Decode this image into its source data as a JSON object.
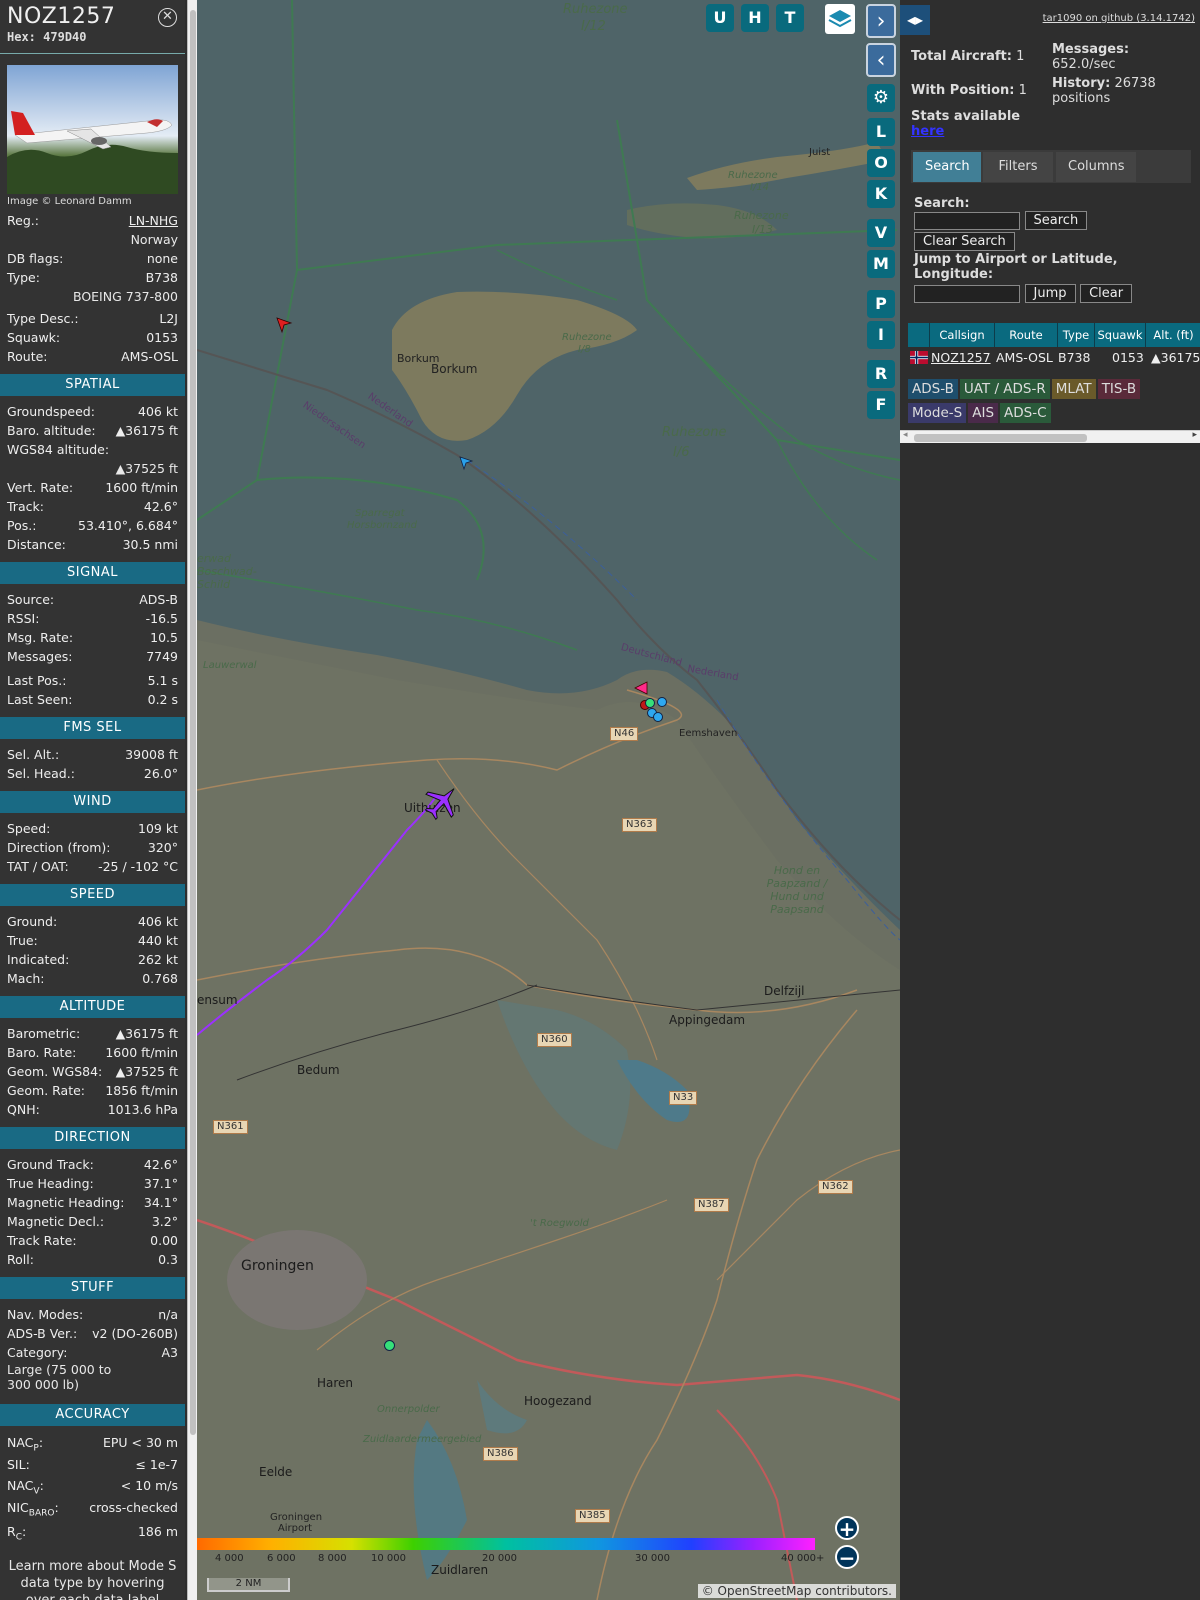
{
  "info": {
    "callsign": "NOZ1257",
    "hex_label": "Hex:",
    "hex": "479D40",
    "photo_credit": "Image © Leonard Damm",
    "reg_label": "Reg.:",
    "reg": "LN-NHG",
    "country": "Norway",
    "dbflags_label": "DB flags:",
    "dbflags": "none",
    "type_label": "Type:",
    "type": "B738",
    "type_full": "BOEING 737-800",
    "typedesc_label": "Type Desc.:",
    "typedesc": "L2J",
    "squawk_label": "Squawk:",
    "squawk": "0153",
    "route_label": "Route:",
    "route": "AMS-OSL"
  },
  "spatial": {
    "title": "SPATIAL",
    "groundspeed_label": "Groundspeed:",
    "groundspeed": "406 kt",
    "baro_label": "Baro. altitude:",
    "baro": "▲36175 ft",
    "wgs_label": "WGS84 altitude:",
    "wgs": "▲37525 ft",
    "vrate_label": "Vert. Rate:",
    "vrate": "1600 ft/min",
    "track_label": "Track:",
    "track": "42.6°",
    "pos_label": "Pos.:",
    "pos": "53.410°, 6.684°",
    "dist_label": "Distance:",
    "dist": "30.5 nmi"
  },
  "signal": {
    "title": "SIGNAL",
    "source_label": "Source:",
    "source": "ADS-B",
    "rssi_label": "RSSI:",
    "rssi": "-16.5",
    "msgrate_label": "Msg. Rate:",
    "msgrate": "10.5",
    "messages_label": "Messages:",
    "messages": "7749",
    "lastpos_label": "Last Pos.:",
    "lastpos": "5.1 s",
    "lastseen_label": "Last Seen:",
    "lastseen": "0.2 s"
  },
  "fms": {
    "title": "FMS SEL",
    "selalt_label": "Sel. Alt.:",
    "selalt": "39008 ft",
    "selhead_label": "Sel. Head.:",
    "selhead": "26.0°"
  },
  "wind": {
    "title": "WIND",
    "speed_label": "Speed:",
    "speed": "109 kt",
    "dir_label": "Direction (from):",
    "dir": "320°",
    "tat_label": "TAT / OAT:",
    "tat": "-25 / -102 °C"
  },
  "speed": {
    "title": "SPEED",
    "ground_label": "Ground:",
    "ground": "406 kt",
    "true_label": "True:",
    "true": "440 kt",
    "indicated_label": "Indicated:",
    "indicated": "262 kt",
    "mach_label": "Mach:",
    "mach": "0.768"
  },
  "altitude": {
    "title": "ALTITUDE",
    "baro_label": "Barometric:",
    "baro": "▲36175 ft",
    "barorate_label": "Baro. Rate:",
    "barorate": "1600 ft/min",
    "geom_label": "Geom. WGS84:",
    "geom": "▲37525 ft",
    "geomrate_label": "Geom. Rate:",
    "geomrate": "1856 ft/min",
    "qnh_label": "QNH:",
    "qnh": "1013.6 hPa"
  },
  "direction": {
    "title": "DIRECTION",
    "gtrack_label": "Ground Track:",
    "gtrack": "42.6°",
    "thead_label": "True Heading:",
    "thead": "37.1°",
    "mhead_label": "Magnetic Heading:",
    "mhead": "34.1°",
    "mdecl_label": "Magnetic Decl.:",
    "mdecl": "3.2°",
    "trate_label": "Track Rate:",
    "trate": "0.00",
    "roll_label": "Roll:",
    "roll": "0.3"
  },
  "stuff": {
    "title": "STUFF",
    "navmodes_label": "Nav. Modes:",
    "navmodes": "n/a",
    "adsbver_label": "ADS-B Ver.:",
    "adsbver": "v2 (DO-260B)",
    "category_label": "Category:",
    "category": "A3",
    "catdesc": "Large (75 000 to 300 000 lb)"
  },
  "accuracy": {
    "title": "ACCURACY",
    "nacp_label": "NAC",
    "nacp_sub": "P",
    "nacp": "EPU < 30 m",
    "sil_label": "SIL:",
    "sil": "≤ 1e-7",
    "nacv_label": "NAC",
    "nacv_sub": "V",
    "nacv": "< 10 m/s",
    "nicbaro_label": "NIC",
    "nicbaro_sub": "BARO",
    "nicbaro": "cross-checked",
    "rc_label": "R",
    "rc_sub": "C",
    "rc": "186 m"
  },
  "footer_text": "Learn more about Mode S data type by hovering over each data label",
  "map": {
    "buttons": [
      "U",
      "H",
      "T"
    ],
    "side_buttons": [
      "L",
      "O",
      "K",
      "V",
      "M",
      "P",
      "I",
      "R",
      "F"
    ],
    "labels": {
      "ruhezone_i12": "Ruhezone",
      "ruhezone_i12b": "I/12",
      "ruhezone_i6": "Ruhezone",
      "ruhezone_i6b": "I/6",
      "ruhezone_i14": "Ruhezone",
      "ruhezone_i14b": "I/14",
      "ruhezone_i13": "Ruhezone",
      "ruhezone_i13b": "I/13",
      "ruhezone_i8": "Ruhezone",
      "ruhezone_i8b": "I/8",
      "juist": "Juist",
      "borkum1": "Borkum",
      "borkum2": "Borkum",
      "sparregat": "Sparregat",
      "horsbornzand": "Horsbornzand",
      "nederland1": "Nederland",
      "niedersachsen": "Niedersachsen",
      "deutschland": "Deutschland",
      "nederland2": "Nederland",
      "eemshaven": "Eemshaven",
      "uithuizen": "Uithuizen",
      "groningen": "Groningen",
      "appingedam": "Appingedam",
      "delfzijl": "Delfzijl",
      "bedum": "Bedum",
      "haren": "Haren",
      "hoogezand": "Hoogezand",
      "eelde": "Eelde",
      "groningen_airport": "Groningen Airport",
      "zuidlaren": "Zuidlaren",
      "hond": "Hond en Paapzand / Hund und Paapsand",
      "roegwold": "'t Roegwold",
      "onnerpolder": "Onnerpolder",
      "zuidlaardermeergebied": "Zuidlaardermeergebied",
      "lauwerwal": "Lauwerwal",
      "boschwad": "erwad Boschwad-Schild",
      "ensum": "ensum"
    },
    "roads": [
      "N46",
      "N363",
      "N360",
      "N33",
      "N361",
      "N387",
      "N362",
      "N386",
      "N385"
    ],
    "scale": "2 NM",
    "attribution": "© OpenStreetMap contributors.",
    "legend_ticks": [
      "4 000",
      "6 000",
      "8 000",
      "10 000",
      "20 000",
      "30 000",
      "40 000+"
    ]
  },
  "sidebar": {
    "github": "tar1090 on github (3.14.1742)",
    "total_aircraft_label": "Total Aircraft:",
    "total_aircraft": "1",
    "with_position_label": "With Position:",
    "with_position": "1",
    "stats_label": "Stats available",
    "stats_link": "here",
    "messages_label": "Messages:",
    "messages": "652.0/sec",
    "history_label": "History:",
    "history": "26738 positions",
    "tabs": [
      "Search",
      "Filters",
      "Columns"
    ],
    "search_label": "Search:",
    "search_btn": "Search",
    "clear_search_btn": "Clear Search",
    "jump_label": "Jump to Airport or Latitude, Longitude:",
    "jump_btn": "Jump",
    "clear_btn": "Clear",
    "columns": [
      "Callsign",
      "Route",
      "Type",
      "Squawk",
      "Alt. (ft)"
    ],
    "rows": [
      {
        "callsign": "NOZ1257",
        "route": "AMS-OSL",
        "type": "B738",
        "squawk": "0153",
        "alt": "▲36175"
      }
    ],
    "badges": [
      "ADS-B",
      "UAT / ADS-R",
      "MLAT",
      "TIS-B",
      "Mode-S",
      "AIS",
      "ADS-C"
    ]
  },
  "colors": {
    "section": "#196a84",
    "table_header": "#0a6a7f",
    "track": "#9b30ff",
    "aircraft": "#9b30ff"
  }
}
